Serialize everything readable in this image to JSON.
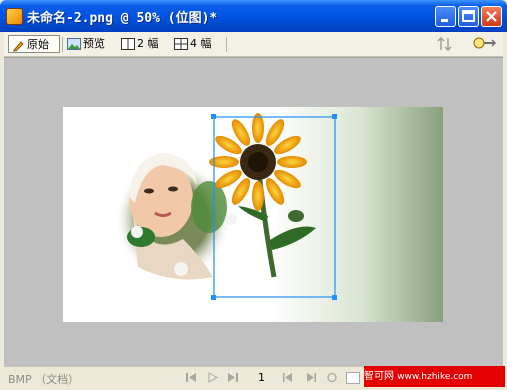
{
  "window": {
    "title": "未命名-2.png @  50% (位图)*"
  },
  "toolbar": {
    "original_label": "原始",
    "preview_label": "预览",
    "two_up_label": "2 幅",
    "four_up_label": "4 幅"
  },
  "status": {
    "doc_type": "BMP （文档）",
    "frame_number": "1"
  },
  "watermark": {
    "brand": "智可网",
    "site": "www.hzhike.com"
  },
  "colors": {
    "titlebar": "#0054e3",
    "canvas": "#c0c0c0",
    "selection": "#1e90ff",
    "watermark": "#e30000"
  },
  "icons": [
    "pencil-icon",
    "preview-icon",
    "two-up-icon",
    "four-up-icon",
    "sort-icon",
    "magnifier-icon"
  ]
}
